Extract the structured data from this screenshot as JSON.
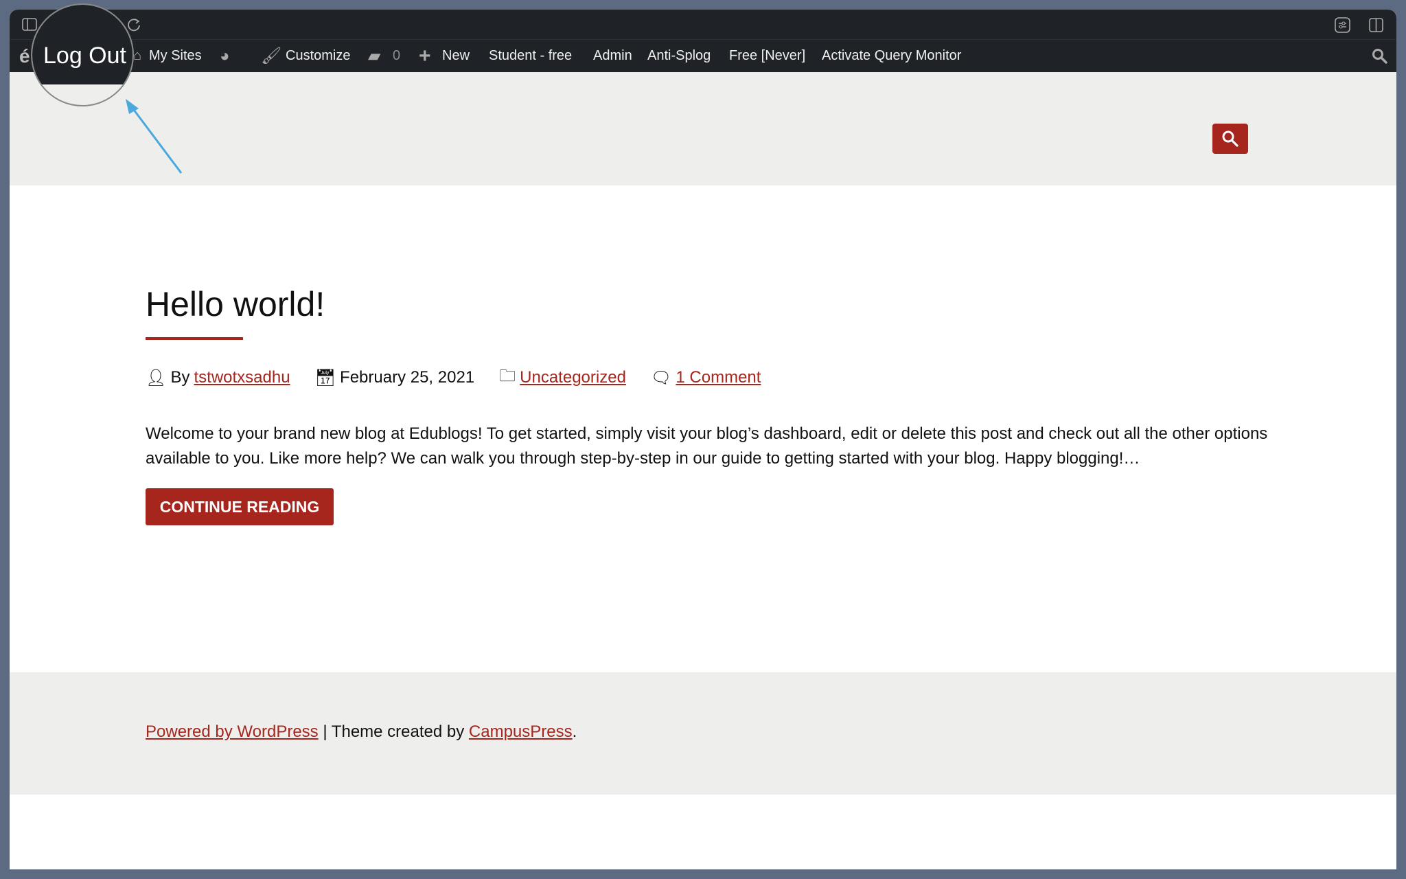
{
  "browser": {
    "icons": [
      "sidebar-icon",
      "reload-icon",
      "settings-icon",
      "split-view-icon"
    ]
  },
  "adminbar": {
    "logout": "Log Out",
    "my_sites": "My Sites",
    "customize": "Customize",
    "comments_count": "0",
    "new": "New",
    "items": [
      "Student - free",
      "Admin",
      "Anti-Splog",
      "Free [Never]",
      "Activate Query Monitor"
    ]
  },
  "post": {
    "title": "Hello world!",
    "by": "By",
    "author": "tstwotxsadhu",
    "date": "February 25, 2021",
    "category": "Uncategorized",
    "comments": "1 Comment",
    "excerpt": "Welcome to your brand new blog at Edublogs! To get started, simply visit your blog’s dashboard, edit or delete this post and check out all the other options available to you. Like more help? We can walk you through step-by-step in our guide to getting started with your blog. Happy blogging!…",
    "continue": "CONTINUE READING"
  },
  "footer": {
    "powered": "Powered by WordPress",
    "sep": " | Theme created by ",
    "theme": "CampusPress",
    "end": "."
  },
  "colors": {
    "accent": "#a6261e",
    "adminbar": "#1f2327",
    "annotation": "#4aa8dc"
  }
}
